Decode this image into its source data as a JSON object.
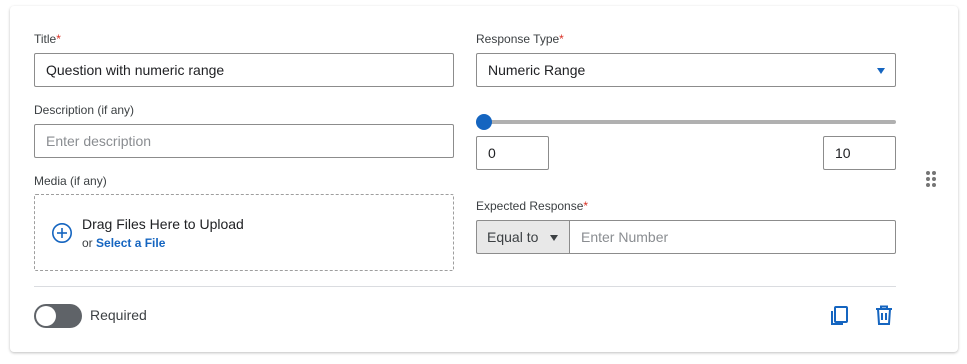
{
  "fields": {
    "title": {
      "label": "Title",
      "required_mark": "*",
      "value": "Question with numeric range"
    },
    "description": {
      "label": "Description (if any)",
      "placeholder": "Enter description"
    },
    "media": {
      "label": "Media (if any)",
      "drag_text": "Drag Files Here to Upload",
      "or_text": "or ",
      "select_link": "Select a File"
    },
    "response_type": {
      "label": "Response Type",
      "required_mark": "*",
      "value": "Numeric Range"
    },
    "range": {
      "min": "0",
      "max": "10",
      "slider_value": 0
    },
    "expected_response": {
      "label": "Expected Response",
      "required_mark": "*",
      "operator": "Equal to",
      "placeholder": "Enter Number"
    }
  },
  "footer": {
    "required_label": "Required",
    "required_on": false
  },
  "icons": {
    "drag_handle": "drag-handle-icon",
    "upload": "add-circle-icon",
    "copy": "copy-icon",
    "delete": "trash-icon"
  },
  "colors": {
    "accent": "#1565c0",
    "required": "#d93025"
  }
}
